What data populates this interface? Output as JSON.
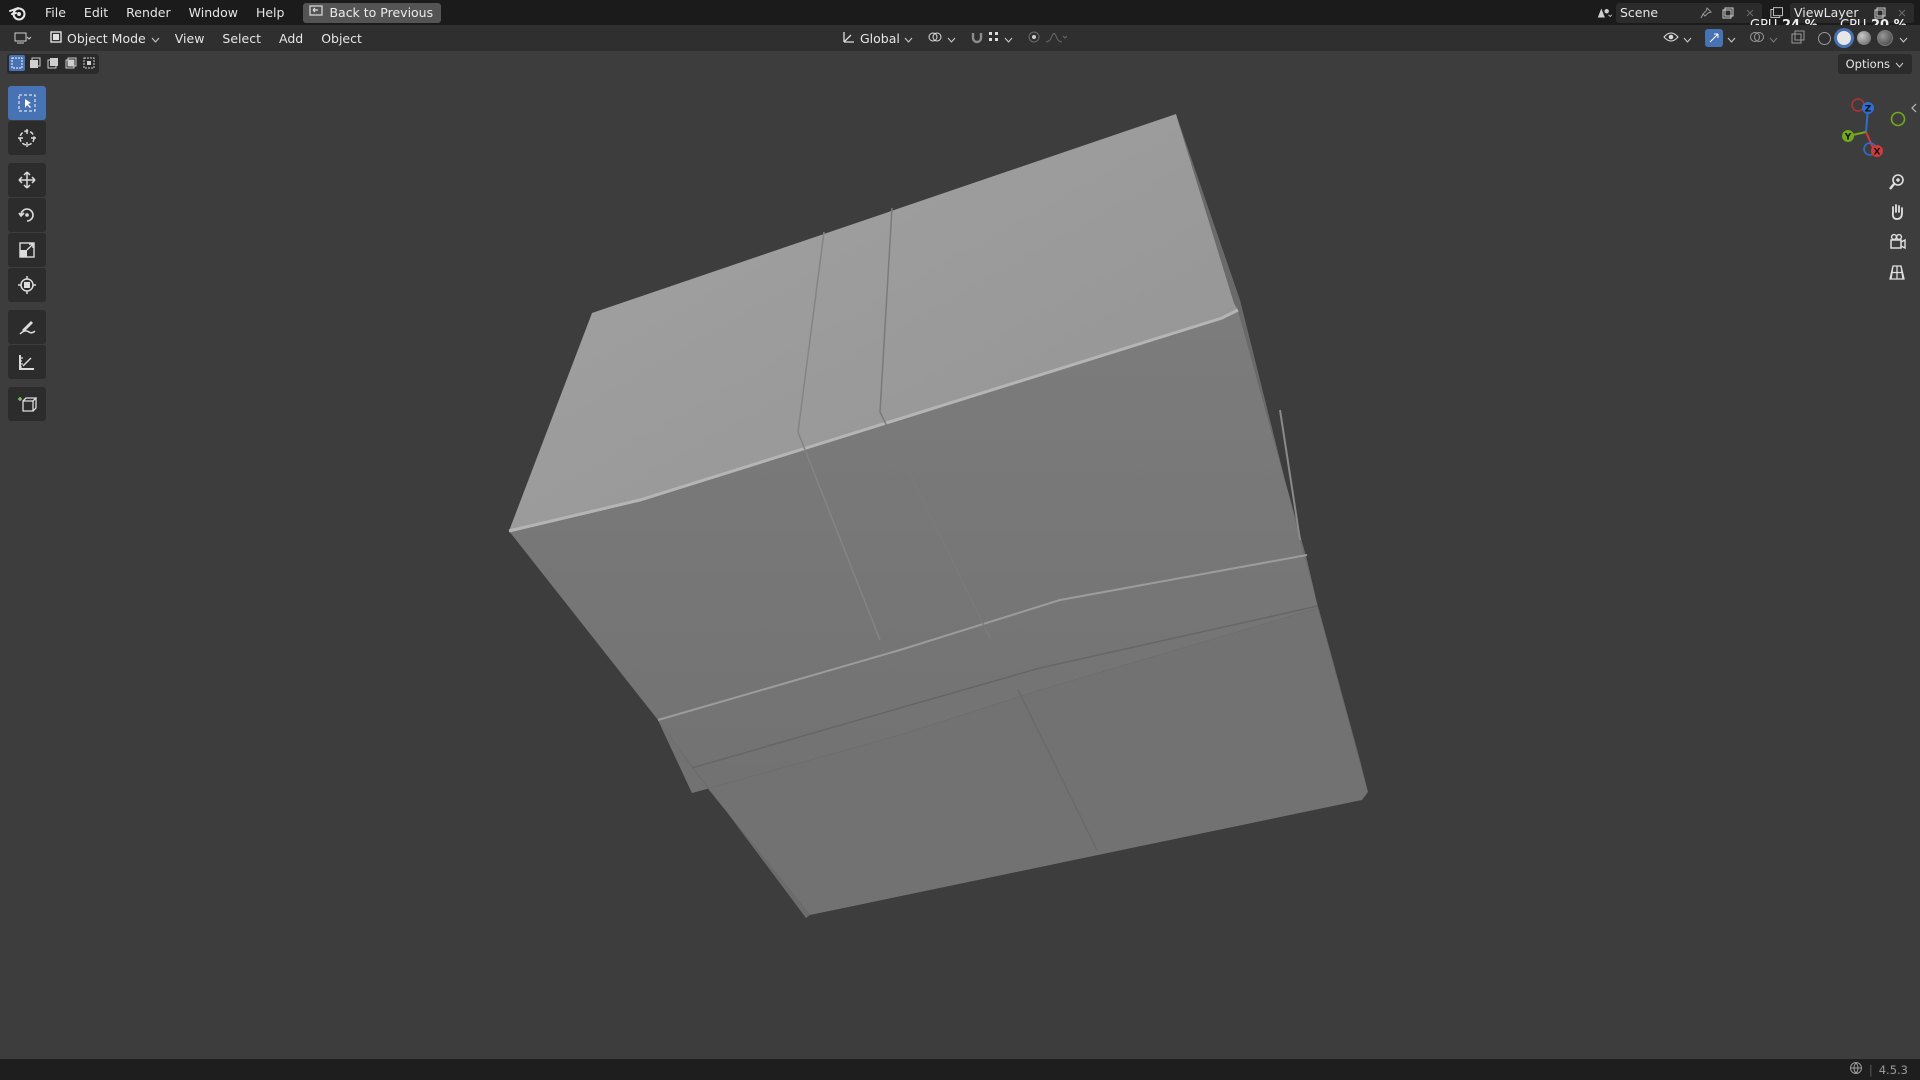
{
  "menubar": {
    "items": [
      "File",
      "Edit",
      "Render",
      "Window",
      "Help"
    ],
    "back_button": "Back to Previous"
  },
  "topright": {
    "scene": "Scene",
    "view_layer": "ViewLayer",
    "gpu_label": "GPU",
    "gpu_value": "24 %",
    "cpu_label": "CPU",
    "cpu_value": "20 %"
  },
  "header": {
    "mode": "Object Mode",
    "menus": [
      "View",
      "Select",
      "Add",
      "Object"
    ],
    "orientation": "Global",
    "options": "Options"
  },
  "toolbar": {
    "tools": [
      "select-box",
      "cursor",
      "move",
      "rotate",
      "scale",
      "transform",
      "annotate",
      "measure",
      "add-cube"
    ],
    "active": "select-box"
  },
  "gizmo": {
    "z_label": "Z",
    "y_label": "Y",
    "x_label": "X"
  },
  "status": {
    "version": "4.5.3"
  },
  "colors": {
    "accent": "#4772b3",
    "axis_x": "#d33a3a",
    "axis_y": "#73a91a",
    "axis_z": "#2f6ed0",
    "viewport_bg": "#3d3d3d"
  }
}
